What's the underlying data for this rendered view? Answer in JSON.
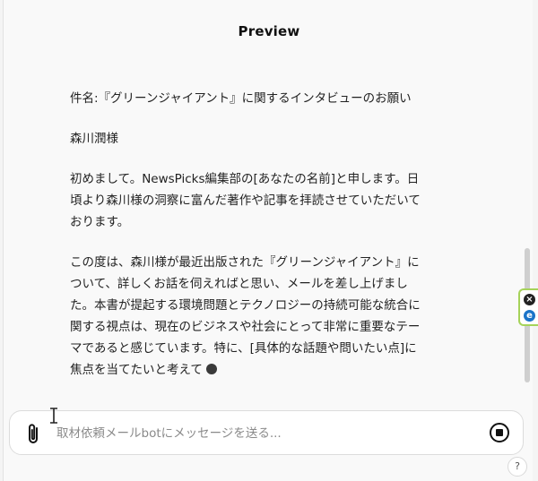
{
  "header": {
    "title": "Preview"
  },
  "email": {
    "subject": "件名:『グリーンジャイアント』に関するインタビューのお願い",
    "salutation": "森川潤様",
    "paragraph1": "初めまして。NewsPicks編集部の[あなたの名前]と申します。日頃より森川様の洞察に富んだ著作や記事を拝読させていただいております。",
    "paragraph2": "この度は、森川様が最近出版された『グリーンジャイアント』について、詳しくお話を伺えればと思い、メールを差し上げました。本書が提起する環境問題とテクノロジーの持続可能な統合に関する視点は、現在のビジネスや社会にとって非常に重要なテーマであると感じています。特に、[具体的な話題や問いたい点]に焦点を当てたいと考えて"
  },
  "composer": {
    "placeholder": "取材依頼メールbotにメッセージを送る..."
  },
  "extension": {
    "close_label": "×",
    "e_label": "e"
  },
  "help": {
    "label": "?"
  },
  "icons": {
    "attach": "paperclip-icon",
    "stop": "stop-icon",
    "cursor": "text-cursor-icon"
  }
}
